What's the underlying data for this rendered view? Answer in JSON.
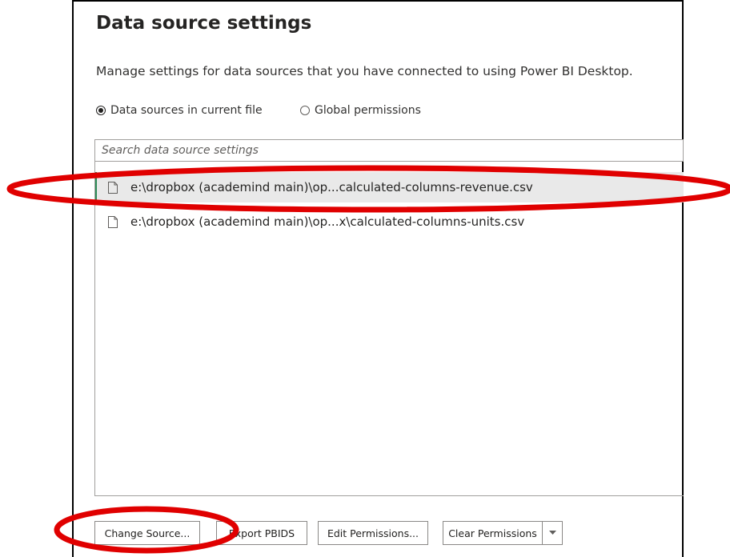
{
  "dialog": {
    "title": "Data source settings",
    "description": "Manage settings for data sources that you have connected to using Power BI Desktop."
  },
  "scope": {
    "options": [
      {
        "label": "Data sources in current file",
        "selected": true
      },
      {
        "label": "Global permissions",
        "selected": false
      }
    ]
  },
  "search": {
    "placeholder": "Search data source settings"
  },
  "sources": [
    {
      "path": "e:\\dropbox (academind main)\\op...calculated-columns-revenue.csv",
      "selected": true
    },
    {
      "path": "e:\\dropbox (academind main)\\op...x\\calculated-columns-units.csv",
      "selected": false
    }
  ],
  "buttons": {
    "change_source": "Change Source...",
    "export_pbids": "Export PBIDS",
    "edit_permissions": "Edit Permissions...",
    "clear_permissions": "Clear Permissions"
  },
  "colors": {
    "annotation": "#e00000",
    "selection_accent": "#2e8b57"
  }
}
